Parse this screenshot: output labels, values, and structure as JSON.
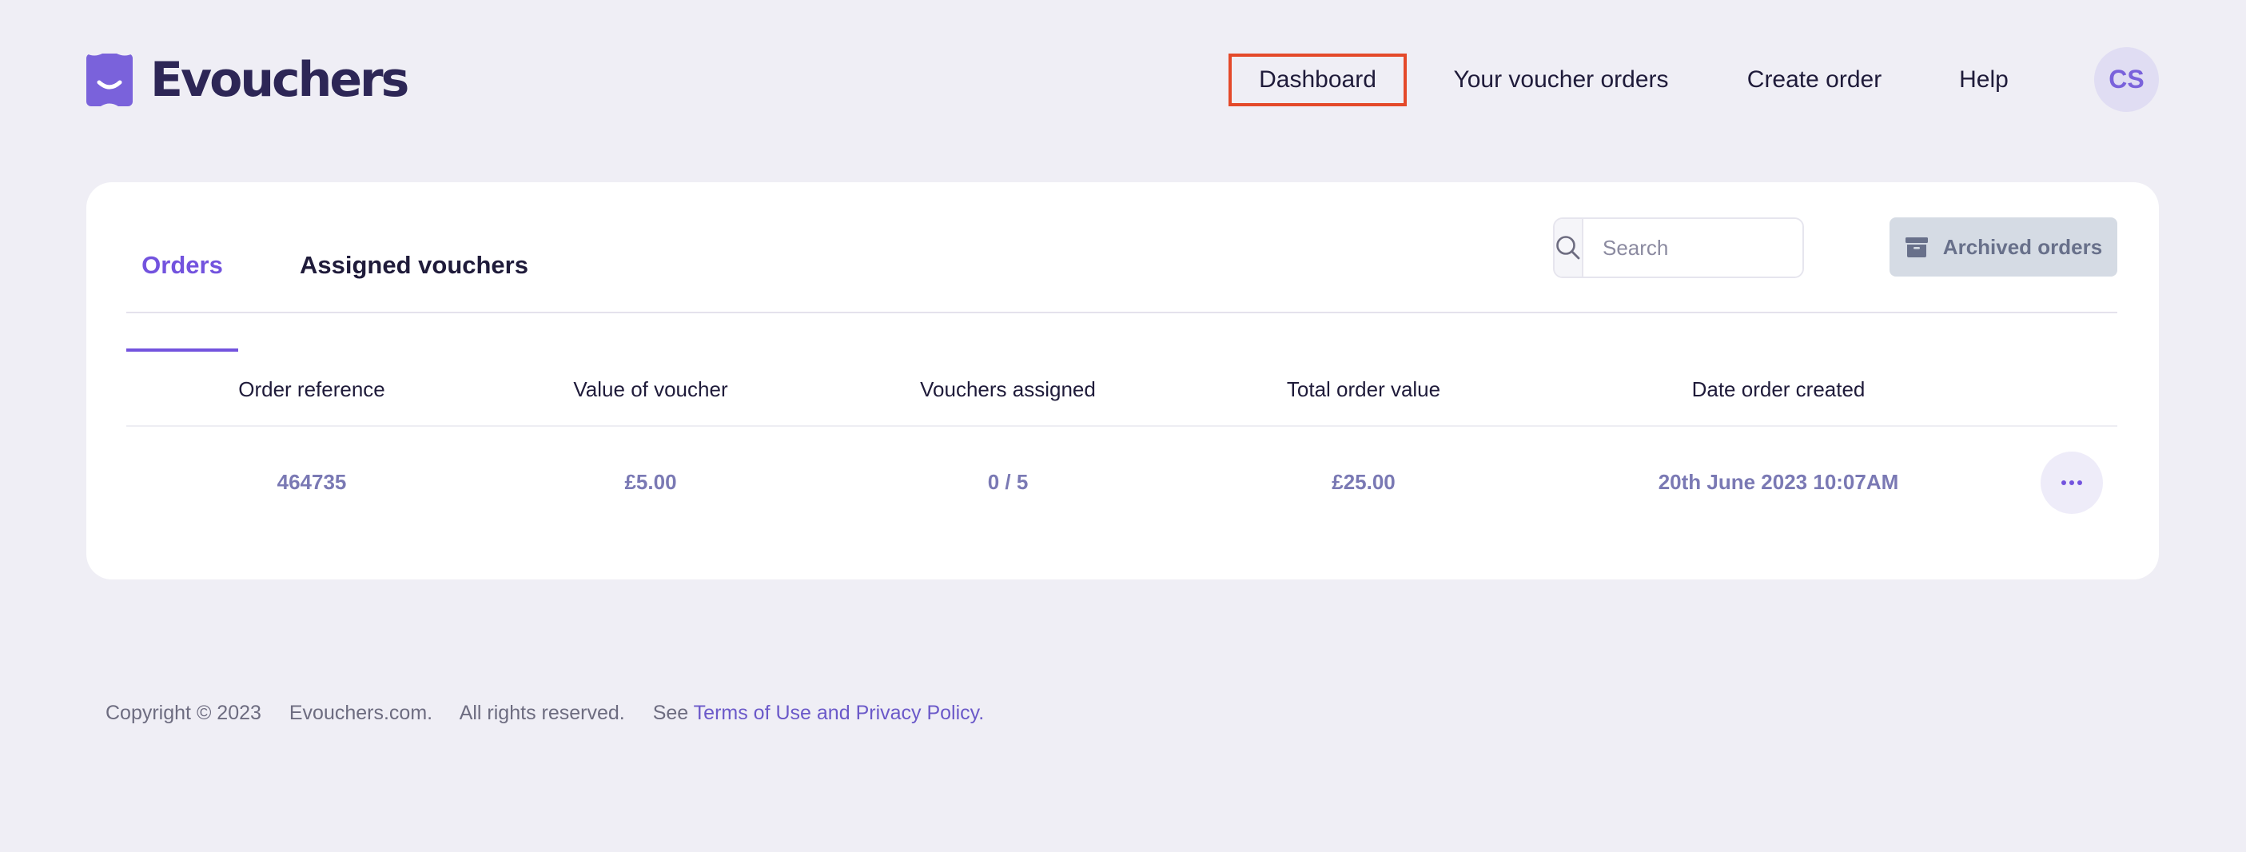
{
  "brand": {
    "name": "Evouchers",
    "color": "#7a62db"
  },
  "nav": {
    "dashboard": "Dashboard",
    "voucher_orders": "Your voucher orders",
    "create_order": "Create order",
    "help": "Help",
    "highlight_color": "#e4492a"
  },
  "user": {
    "initials": "CS"
  },
  "tabs": {
    "orders": "Orders",
    "assigned_vouchers": "Assigned vouchers",
    "active": "Orders"
  },
  "search": {
    "placeholder": "Search",
    "icon": "search-icon"
  },
  "archived": {
    "label": "Archived orders",
    "icon": "archive-box-icon"
  },
  "table": {
    "columns": [
      "Order reference",
      "Value of voucher",
      "Vouchers assigned",
      "Total order value",
      "Date order created"
    ],
    "rows": [
      {
        "reference": "464735",
        "voucher_value": "£5.00",
        "assigned": "0 / 5",
        "total": "£25.00",
        "created": "20th June 2023 10:07AM"
      }
    ],
    "row_menu_icon": "more-dots-icon"
  },
  "footer": {
    "copyright": "Copyright © 2023",
    "site": "Evouchers.com.",
    "rights": "All rights reserved.",
    "see": "See",
    "terms": "Terms of Use",
    "and": "and",
    "privacy": "Privacy Policy."
  }
}
